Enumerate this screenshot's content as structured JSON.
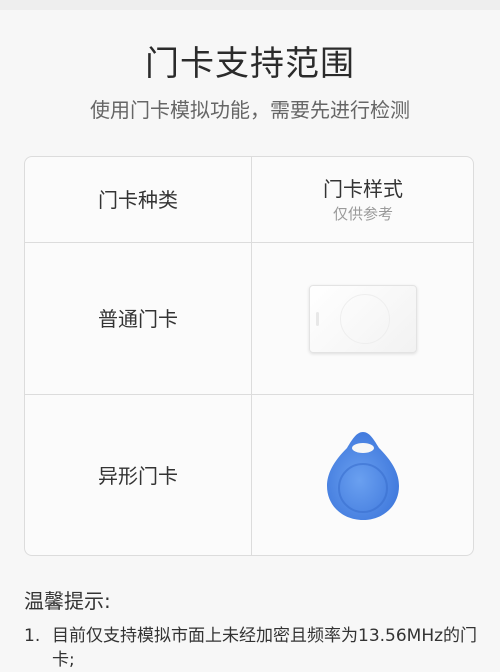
{
  "header": {
    "title": "门卡支持范围",
    "subtitle": "使用门卡模拟功能，需要先进行检测"
  },
  "table": {
    "col_type": "门卡种类",
    "col_style": "门卡样式",
    "col_style_note": "仅供参考",
    "rows": [
      {
        "type": "普通门卡",
        "image": "white-rectangular-card"
      },
      {
        "type": "异形门卡",
        "image": "blue-teardrop-key-fob"
      }
    ]
  },
  "tips": {
    "title": "温馨提示:",
    "items": [
      {
        "num": "1.",
        "text": "目前仅支持模拟市面上未经加密且频率为13.56MHz的门卡;"
      }
    ]
  },
  "colors": {
    "fob_blue": "#4a86e8",
    "border": "#dcdcdc"
  }
}
